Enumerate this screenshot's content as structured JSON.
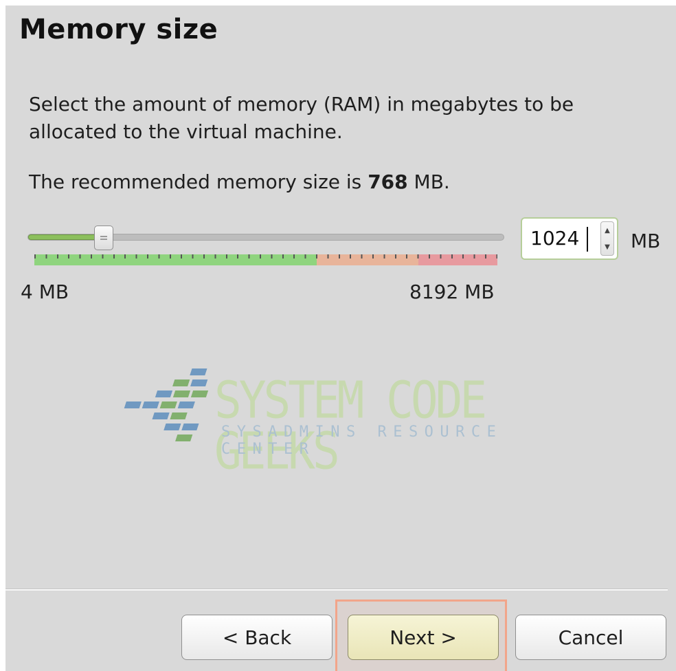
{
  "page": {
    "title": "Memory size",
    "description": "Select the amount of memory (RAM) in megabytes to be allocated to the virtual machine.",
    "recommended_prefix": "The recommended memory size is",
    "recommended_value": "768",
    "recommended_unit": "MB."
  },
  "slider": {
    "min_label": "4 MB",
    "max_label": "8192 MB",
    "value_mb": 1024,
    "min_mb": 4,
    "max_mb": 8192
  },
  "spinbox": {
    "value": "1024",
    "unit": "MB"
  },
  "watermark": {
    "main": "SYSTEM CODE GEEKS",
    "sub": "SYSADMINS RESOURCE CENTER"
  },
  "buttons": {
    "back": "< Back",
    "next": "Next >",
    "cancel": "Cancel"
  },
  "colors": {
    "zone_safe": "#8fd47e",
    "zone_warn": "#e8b49a",
    "zone_danger": "#e79a9f",
    "highlight": "#f2a58a"
  }
}
